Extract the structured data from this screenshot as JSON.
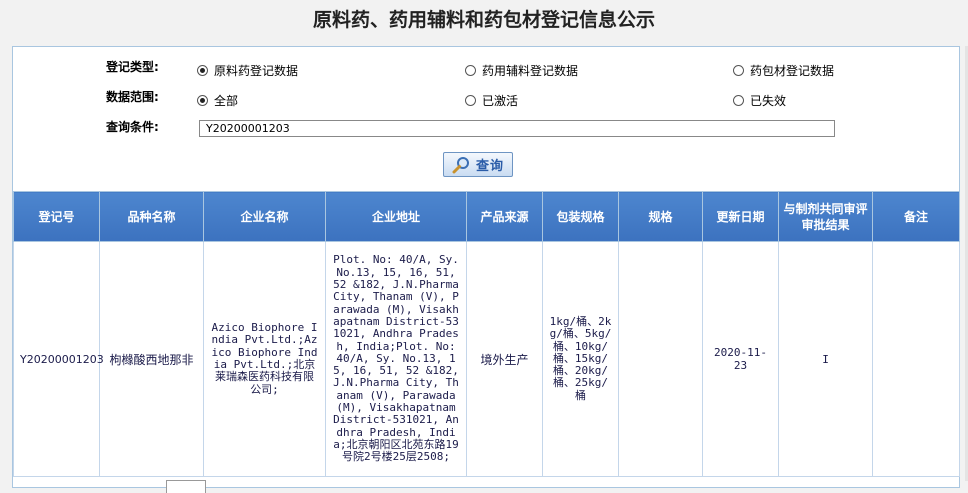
{
  "page": {
    "title": "原料药、药用辅料和药包材登记信息公示"
  },
  "form": {
    "type_label": "登记类型:",
    "type_options": [
      {
        "label": "原料药登记数据",
        "selected": true
      },
      {
        "label": "药用辅料登记数据",
        "selected": false
      },
      {
        "label": "药包材登记数据",
        "selected": false
      }
    ],
    "scope_label": "数据范围:",
    "scope_options": [
      {
        "label": "全部",
        "selected": true
      },
      {
        "label": "已激活",
        "selected": false
      },
      {
        "label": "已失效",
        "selected": false
      }
    ],
    "query_label": "查询条件:",
    "query_value": "Y20200001203",
    "query_button": "查询"
  },
  "table": {
    "headers": [
      "登记号",
      "品种名称",
      "企业名称",
      "企业地址",
      "产品来源",
      "包装规格",
      "规格",
      "更新日期",
      "与制剂共同审评审批结果",
      "备注"
    ],
    "rows": [
      {
        "reg_no": "Y20200001203",
        "product": "枸橼酸西地那非",
        "company": "Azico Biophore India Pvt.Ltd.;Azico Biophore India Pvt.Ltd.;北京莱瑞森医药科技有限公司;",
        "address": "Plot. No: 40/A, Sy. No.13, 15, 16, 51, 52 &182, J.N.Pharma City, Thanam (V), Parawada (M), Visakhapatnam District-531021, Andhra Pradesh, India;Plot. No: 40/A, Sy. No.13, 15, 16, 51, 52 &182, J.N.Pharma City, Thanam (V), Parawada (M), Visakhapatnam District-531021, Andhra Pradesh, India;北京朝阳区北苑东路19号院2号楼25层2508;",
        "source": "境外生产",
        "packaging": "1kg/桶、2kg/桶、5kg/桶、10kg/桶、15kg/桶、20kg/桶、25kg/桶",
        "spec": "",
        "updated": "2020-11-23",
        "review_result": "I",
        "remark": ""
      }
    ]
  },
  "colors": {
    "header_bg": "#4079c6",
    "panel_border": "#a9c6e0",
    "button_text": "#2a5ca8"
  }
}
